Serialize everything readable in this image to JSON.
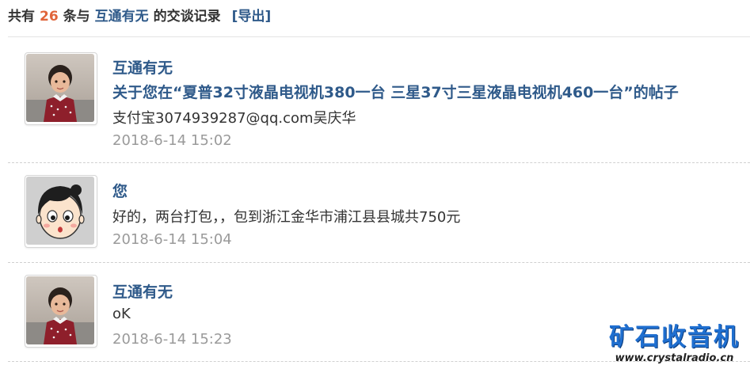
{
  "summary": {
    "prefix": "共有",
    "count": "26",
    "middle": "条与",
    "partner": "互通有无",
    "suffix": "的交谈记录",
    "export_label": "[导出]"
  },
  "messages": [
    {
      "sender": "互通有无",
      "avatar": "child-photo-avatar",
      "post_title": "关于您在“夏普32寸液晶电视机380一台 三星37寸三星液晶电视机460一台”的帖子",
      "text": "支付宝3074939287@qq.com吴庆华",
      "time": "2018-6-14 15:02"
    },
    {
      "sender": "您",
      "avatar": "cartoon-face-avatar",
      "text": "好的，两台打包，，包到浙江金华市浦江县县城共750元",
      "time": "2018-6-14 15:04"
    },
    {
      "sender": "互通有无",
      "avatar": "child-photo-avatar",
      "text": "oK",
      "time": "2018-6-14 15:23"
    }
  ],
  "watermark": {
    "title": "矿石收音机",
    "url": "www.crystalradio.cn",
    "color": "#1f6fd0"
  },
  "colors": {
    "link": "#2f5a8a",
    "count": "#e0643a",
    "time": "#9a9a9a",
    "text": "#333333"
  }
}
